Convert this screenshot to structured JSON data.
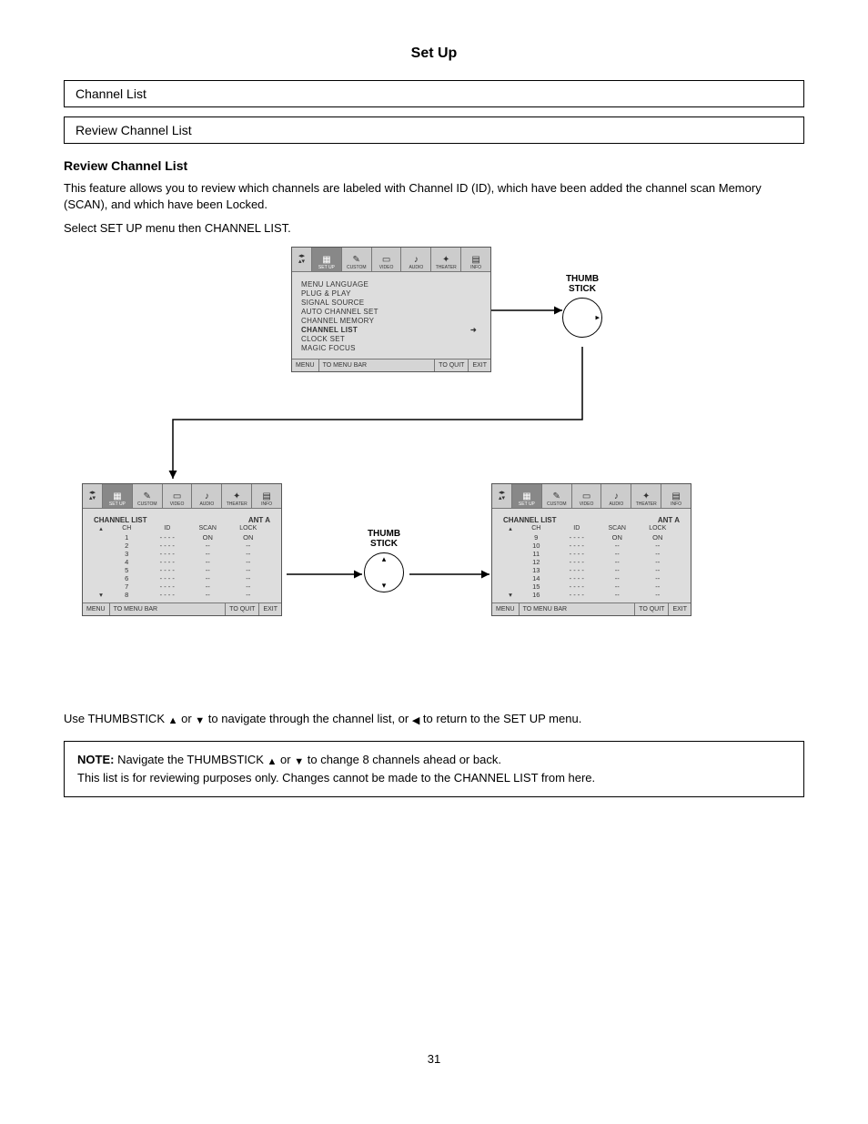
{
  "page": {
    "title": "Set Up",
    "h1": "Channel List",
    "h2": "Review Channel List",
    "intro_1": "This feature allows you to review which channels are labeled with Channel ID (ID), which have been added the channel scan Memory (SCAN), and which have been Locked.",
    "step1": "Select SET UP menu then CHANNEL LIST.",
    "thumb_label": "THUMB\nSTICK",
    "step2_a": "Use THUMBSTICK ",
    "step2_b": " or ",
    "step2_c": " to navigate through the channel list, or ",
    "step2_d": " to return to the SET UP menu.",
    "note_strong": "NOTE:",
    "note_1a": "  Navigate the THUMBSTICK ",
    "note_1b": " or ",
    "note_1c": " to change 8 channels ahead or back.",
    "note_2": "This list is for reviewing purposes only. Changes cannot be made to the CHANNEL LIST from here.",
    "page_number": "31"
  },
  "osd_common": {
    "tabs": [
      "SET UP",
      "CUSTOM",
      "VIDEO",
      "AUDIO",
      "THEATER",
      "INFO"
    ],
    "footer_menu": "MENU",
    "footer_tobar": "TO MENU BAR",
    "footer_toquit": "TO QUIT",
    "footer_exit": "EXIT"
  },
  "osd_setup": {
    "items": [
      "MENU LANGUAGE",
      "PLUG & PLAY",
      "SIGNAL SOURCE",
      "AUTO CHANNEL SET",
      "CHANNEL MEMORY",
      "CHANNEL LIST",
      "CLOCK SET",
      "MAGIC FOCUS"
    ],
    "selected_index": 5
  },
  "osd_list": {
    "title_left": "CHANNEL LIST",
    "title_right": "ANT A",
    "cols": [
      "CH",
      "ID",
      "SCAN",
      "LOCK"
    ]
  },
  "chart_data": [
    {
      "type": "table",
      "title": "CHANNEL LIST (page 1)",
      "columns": [
        "CH",
        "ID",
        "SCAN",
        "LOCK"
      ],
      "rows": [
        [
          "1",
          "- - - -",
          "ON",
          "ON"
        ],
        [
          "2",
          "- - - -",
          "--",
          "--"
        ],
        [
          "3",
          "- - - -",
          "--",
          "--"
        ],
        [
          "4",
          "- - - -",
          "--",
          "--"
        ],
        [
          "5",
          "- - - -",
          "--",
          "--"
        ],
        [
          "6",
          "- - - -",
          "--",
          "--"
        ],
        [
          "7",
          "- - - -",
          "--",
          "--"
        ],
        [
          "8",
          "- - - -",
          "--",
          "--"
        ]
      ]
    },
    {
      "type": "table",
      "title": "CHANNEL LIST (page 2)",
      "columns": [
        "CH",
        "ID",
        "SCAN",
        "LOCK"
      ],
      "rows": [
        [
          "9",
          "- - - -",
          "ON",
          "ON"
        ],
        [
          "10",
          "- - - -",
          "--",
          "--"
        ],
        [
          "11",
          "- - - -",
          "--",
          "--"
        ],
        [
          "12",
          "- - - -",
          "--",
          "--"
        ],
        [
          "13",
          "- - - -",
          "--",
          "--"
        ],
        [
          "14",
          "- - - -",
          "--",
          "--"
        ],
        [
          "15",
          "- - - -",
          "--",
          "--"
        ],
        [
          "16",
          "- - - -",
          "--",
          "--"
        ]
      ]
    }
  ]
}
